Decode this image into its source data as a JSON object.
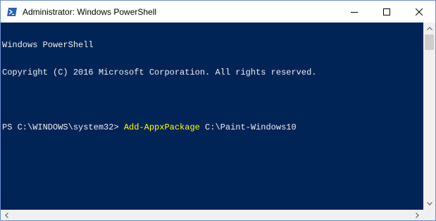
{
  "window": {
    "title": "Administrator: Windows PowerShell",
    "app_icon": "powershell-icon",
    "controls": [
      "minimize-icon",
      "maximize-icon",
      "close-icon"
    ]
  },
  "console": {
    "lines": [
      "Windows PowerShell",
      "Copyright (C) 2016 Microsoft Corporation. All rights reserved.",
      ""
    ],
    "prompt": "PS C:\\WINDOWS\\system32> ",
    "command": "Add-AppxPackage",
    "argument": " C:\\Paint-Windows10"
  },
  "colors": {
    "console_background": "#012456",
    "console_text": "#eeedf0",
    "command_text": "#ffff00",
    "window_border": "#6b8fd0"
  }
}
